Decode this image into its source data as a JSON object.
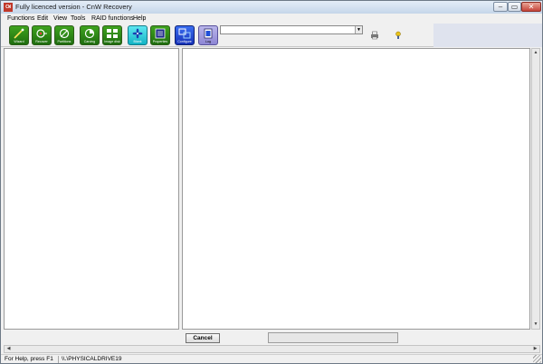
{
  "window": {
    "title": "Fully licenced version - CnW Recovery",
    "app_icon_text": "CW"
  },
  "menu": [
    "Functions",
    "Edit",
    "View",
    "Tools",
    "RAID functions",
    "Help"
  ],
  "toolbar": {
    "buttons": [
      {
        "label": "Wizard",
        "icon": "wand-icon",
        "color": "#2f8f19"
      },
      {
        "label": "Recover",
        "icon": "recover-icon",
        "color": "#2f8f19"
      },
      {
        "label": "Partitions",
        "icon": "partitions-icon",
        "color": "#2f8f19"
      },
      {
        "label": "Carving",
        "icon": "carving-icon",
        "color": "#2f8f19"
      },
      {
        "label": "Image disk",
        "icon": "image-disk-icon",
        "color": "#2f8f19"
      },
      {
        "label": "Blank",
        "icon": "fan-icon",
        "color": "#19c0d0"
      },
      {
        "label": "Properties",
        "icon": "properties-icon",
        "color": "#2f8f19"
      },
      {
        "label": "Configure",
        "icon": "configure-icon",
        "color": "#1d3fd0"
      },
      {
        "label": "Log",
        "icon": "log-icon",
        "color": "#9a94dc"
      }
    ],
    "combo_value": "",
    "print_icon": "printer-icon",
    "help_icon": "help-icon"
  },
  "actions": {
    "cancel_label": "Cancel",
    "progress": 0
  },
  "status": {
    "help_text": "For Help, press F1",
    "drive": "\\\\.\\PHYSICALDRIVE19"
  }
}
